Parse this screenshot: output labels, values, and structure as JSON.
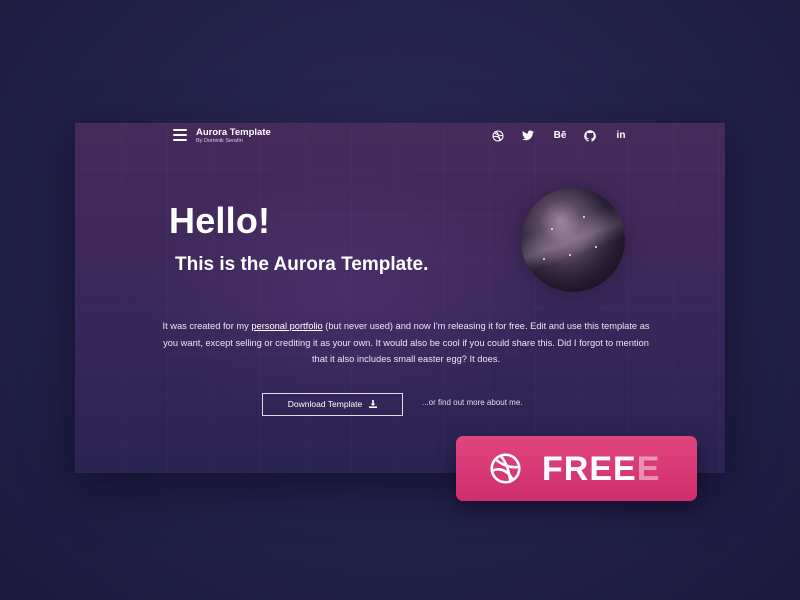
{
  "header": {
    "brand_title": "Aurora Template",
    "brand_subtitle": "By Dominik Serafin",
    "social": [
      {
        "name": "dribbble",
        "label": ""
      },
      {
        "name": "twitter",
        "label": ""
      },
      {
        "name": "behance",
        "label": "Bē"
      },
      {
        "name": "github",
        "label": ""
      },
      {
        "name": "linkedin",
        "label": "in"
      }
    ]
  },
  "hero": {
    "greeting": "Hello!",
    "subtitle": "This is the Aurora Template.",
    "para_1": "It was created for my ",
    "para_link": "personal portfolio",
    "para_2": " (but never used) and now I'm releasing it for free. Edit and use this template as you want, except selling or crediting it as your own. It would also be cool if you could share this. Did I forgot to mention that it also includes small easter egg? It does."
  },
  "actions": {
    "download_label": "Download Template",
    "more_label": "...or find out more about me."
  },
  "badge": {
    "text_main": "FREE",
    "text_ghost": "E",
    "color_top": "#e0467e",
    "color_bottom": "#cf2e6c"
  },
  "colors": {
    "background": "#24234b",
    "frame_top": "#4a2c5e",
    "frame_bottom": "#2f2858"
  }
}
